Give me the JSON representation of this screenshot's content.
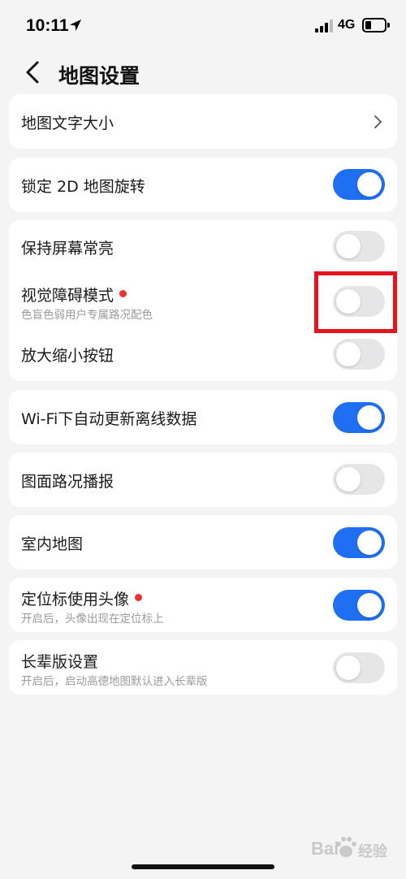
{
  "status_bar": {
    "time": "10:11",
    "network": "4G"
  },
  "nav": {
    "title": "地图设置"
  },
  "colors": {
    "accent": "#1f6ff2",
    "toggle_off": "#e6e6e8",
    "red_dot": "#f0322e",
    "highlight": "#e3141b"
  },
  "settings": {
    "map_font_size": {
      "label": "地图文字大小"
    },
    "lock_2d_rotation": {
      "label": "锁定 2D 地图旋转",
      "enabled": true
    },
    "keep_screen_on": {
      "label": "保持屏幕常亮",
      "enabled": false
    },
    "visual_impairment_mode": {
      "label": "视觉障碍模式",
      "subtitle": "色盲色弱用户专属路况配色",
      "enabled": false
    },
    "zoom_buttons": {
      "label": "放大缩小按钮",
      "enabled": false
    },
    "wifi_auto_update": {
      "label": "Wi-Fi下自动更新离线数据",
      "enabled": true
    },
    "traffic_broadcast": {
      "label": "图面路况播报",
      "enabled": false
    },
    "indoor_map": {
      "label": "室内地图",
      "enabled": true
    },
    "avatar_marker": {
      "label": "定位标使用头像",
      "subtitle": "开启后，头像出现在定位标上",
      "enabled": true
    },
    "elder_mode": {
      "label": "长辈版设置",
      "subtitle": "开启后，启动高德地图默认进入长辈版",
      "enabled": false
    }
  },
  "watermark": {
    "brand_left": "Bai",
    "brand_right": "经验"
  }
}
